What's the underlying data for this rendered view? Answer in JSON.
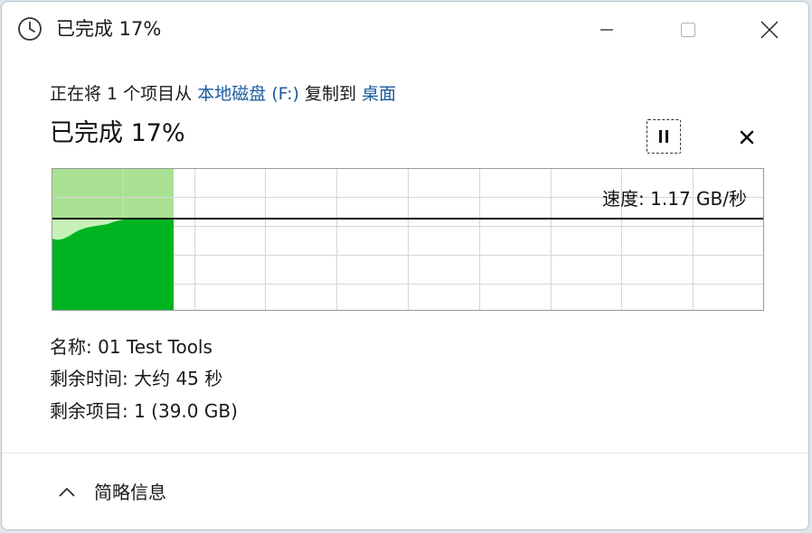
{
  "window": {
    "title": "已完成 17%",
    "icon": "clock-icon"
  },
  "copy": {
    "prefix": "正在将 1 个项目从 ",
    "source": "本地磁盘 (F:)",
    "middle": " 复制到 ",
    "destination": "桌面"
  },
  "status": "已完成 17%",
  "progress_percent": 17,
  "speed": "速度: 1.17 GB/秒",
  "details": {
    "name": "名称: 01 Test Tools",
    "time_remaining": "剩余时间: 大约 45 秒",
    "items_remaining": "剩余项目: 1 (39.0 GB)"
  },
  "footer": {
    "toggle_label": "简略信息"
  },
  "colors": {
    "progress_fill": "#a8e193",
    "speed_area": "#00b421",
    "speed_area_light": "#c6f0b8",
    "grid": "#d6d6d6",
    "link": "#1a5a9c"
  }
}
